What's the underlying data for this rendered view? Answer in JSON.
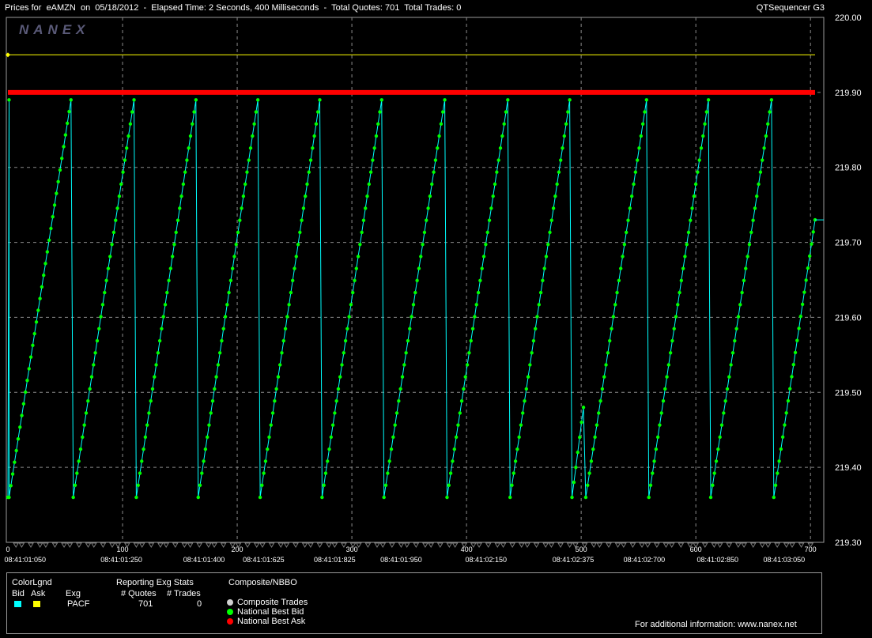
{
  "header": {
    "title": "Prices for  eAMZN  on  05/18/2012  -  Elapsed Time: 2 Seconds, 400 Milliseconds  -  Total Quotes: 701  Total Trades: 0",
    "app_name": "QTSequencer G3",
    "logo_text": "NANEX"
  },
  "chart_data": {
    "type": "line",
    "title": "Prices for  eAMZN  on  05/18/2012",
    "x_ticks": [
      0,
      100,
      200,
      300,
      400,
      500,
      600,
      700
    ],
    "time_ticks": [
      {
        "x": 15,
        "label": "08:41:01:050"
      },
      {
        "x": 99,
        "label": "08:41:01:250"
      },
      {
        "x": 171,
        "label": "08:41:01:400"
      },
      {
        "x": 223,
        "label": "08:41:01:625"
      },
      {
        "x": 285,
        "label": "08:41:01:825"
      },
      {
        "x": 343,
        "label": "08:41:01:950"
      },
      {
        "x": 417,
        "label": "08:41:02:150"
      },
      {
        "x": 493,
        "label": "08:41:02:375"
      },
      {
        "x": 555,
        "label": "08:41:02:700"
      },
      {
        "x": 619,
        "label": "08:41:02:850"
      },
      {
        "x": 677,
        "label": "08:41:03:050"
      }
    ],
    "y_ticks": [
      "220.00",
      "219.90",
      "219.80",
      "219.70",
      "219.60",
      "219.50",
      "219.40",
      "219.30"
    ],
    "xlim": [
      0,
      704
    ],
    "ylim": [
      219.3,
      220.0
    ],
    "grid": true,
    "series": [
      {
        "name": "National Best Ask",
        "color": "#ff0000",
        "values": [
          [
            0,
            219.9
          ],
          [
            704,
            219.9
          ]
        ]
      },
      {
        "name": "Ask",
        "color": "#ffff00",
        "values": [
          [
            0,
            219.95
          ],
          [
            704,
            219.95
          ]
        ]
      },
      {
        "name": "National Best Bid",
        "color": "#00ff00",
        "bid_color": "#00ffff",
        "cycles": [
          {
            "start": 0,
            "end": 1,
            "from": 219.36,
            "to": 219.89
          },
          {
            "start": 1,
            "end": 55,
            "from": 219.36,
            "to": 219.89
          },
          {
            "start": 57,
            "end": 110,
            "from": 219.36,
            "to": 219.89
          },
          {
            "start": 112,
            "end": 164,
            "from": 219.36,
            "to": 219.89
          },
          {
            "start": 166,
            "end": 218,
            "from": 219.36,
            "to": 219.89
          },
          {
            "start": 220,
            "end": 272,
            "from": 219.36,
            "to": 219.89
          },
          {
            "start": 274,
            "end": 326,
            "from": 219.36,
            "to": 219.89
          },
          {
            "start": 328,
            "end": 381,
            "from": 219.36,
            "to": 219.89
          },
          {
            "start": 383,
            "end": 436,
            "from": 219.36,
            "to": 219.89
          },
          {
            "start": 438,
            "end": 490,
            "from": 219.36,
            "to": 219.89
          },
          {
            "start": 492,
            "end": 502,
            "from": 219.36,
            "to": 219.48
          },
          {
            "start": 504,
            "end": 557,
            "from": 219.36,
            "to": 219.89
          },
          {
            "start": 559,
            "end": 611,
            "from": 219.36,
            "to": 219.89
          },
          {
            "start": 613,
            "end": 666,
            "from": 219.36,
            "to": 219.89
          },
          {
            "start": 668,
            "end": 704,
            "from": 219.36,
            "to": 219.73
          }
        ]
      }
    ]
  },
  "legend": {
    "color_legend_title": "ColorLgnd",
    "bid_label": "Bid",
    "ask_label": "Ask",
    "bid_color": "#00ffff",
    "ask_color": "#ffff00",
    "exg_header": "Exg",
    "exg_value": "PACF",
    "stats_title": "Reporting Exg Stats",
    "quotes_header": "# Quotes",
    "trades_header": "# Trades",
    "quotes_value": "701",
    "trades_value": "0",
    "composite_title": "Composite/NBBO",
    "items": [
      {
        "label": "Composite Trades",
        "color": "#d0d0d0"
      },
      {
        "label": "National Best Bid",
        "color": "#00ff00"
      },
      {
        "label": "National Best Ask",
        "color": "#ff0000"
      }
    ],
    "footer": "For additional information: www.nanex.net"
  }
}
